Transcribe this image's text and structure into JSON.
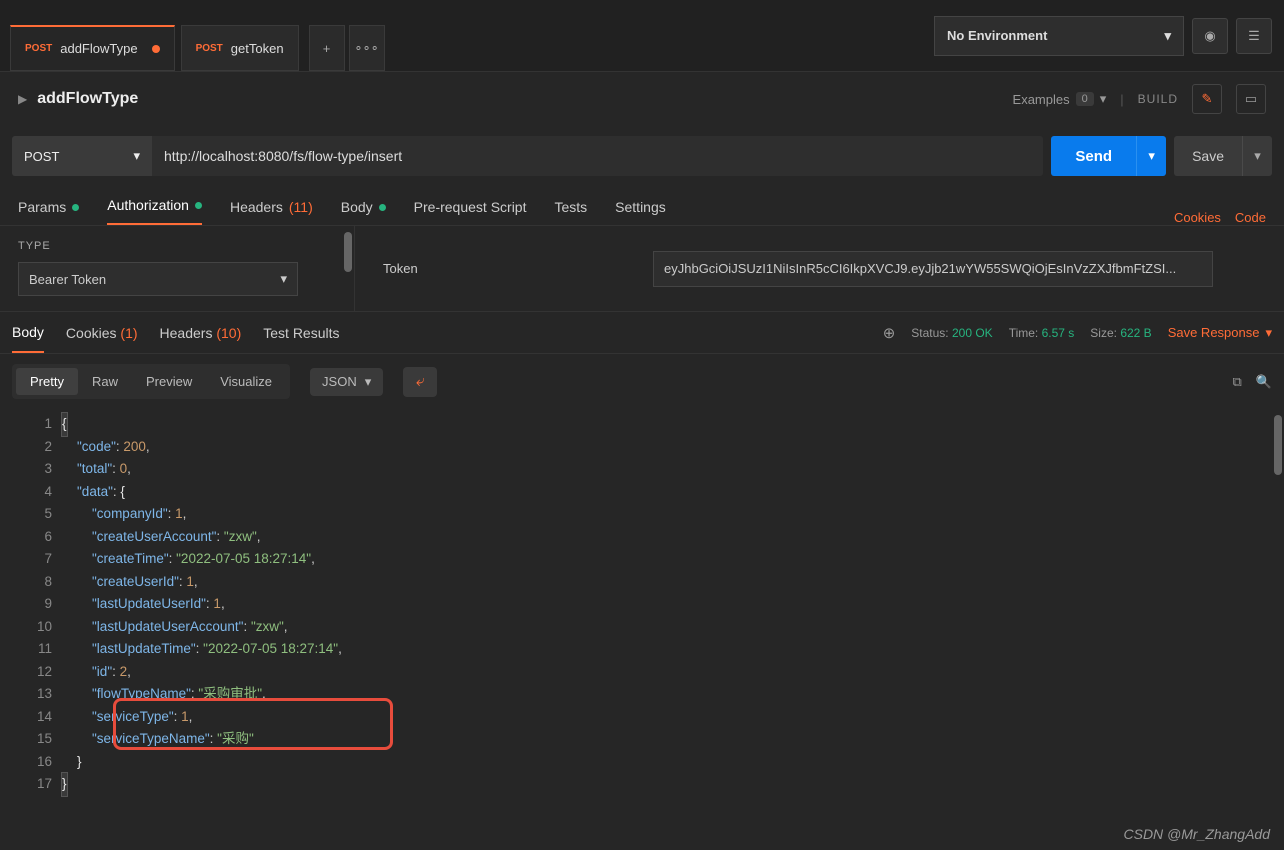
{
  "tabs": [
    {
      "method": "POST",
      "name": "addFlowType",
      "dirty": true,
      "active": true
    },
    {
      "method": "POST",
      "name": "getToken",
      "dirty": false,
      "active": false
    }
  ],
  "environment": {
    "selected": "No Environment"
  },
  "request": {
    "name": "addFlowType",
    "examples_label": "Examples",
    "examples_count": "0",
    "build_label": "BUILD",
    "method": "POST",
    "url": "http://localhost:8080/fs/flow-type/insert",
    "send_label": "Send",
    "save_label": "Save"
  },
  "request_tabs": {
    "params": "Params",
    "authorization": "Authorization",
    "headers": "Headers",
    "headers_count": "(11)",
    "body": "Body",
    "prerequest": "Pre-request Script",
    "tests": "Tests",
    "settings": "Settings",
    "cookies": "Cookies",
    "code": "Code"
  },
  "auth": {
    "type_label": "TYPE",
    "type_value": "Bearer Token",
    "token_label": "Token",
    "token_value": "eyJhbGciOiJSUzI1NiIsInR5cCI6IkpXVCJ9.eyJjb21wYW55SWQiOjEsInVzZXJfbmFtZSI..."
  },
  "response_tabs": {
    "body": "Body",
    "cookies": "Cookies",
    "cookies_count": "(1)",
    "headers": "Headers",
    "headers_count": "(10)",
    "test_results": "Test Results"
  },
  "response_meta": {
    "status_label": "Status:",
    "status_value": "200 OK",
    "time_label": "Time:",
    "time_value": "6.57 s",
    "size_label": "Size:",
    "size_value": "622 B",
    "save_response": "Save Response"
  },
  "view": {
    "pretty": "Pretty",
    "raw": "Raw",
    "preview": "Preview",
    "visualize": "Visualize",
    "format": "JSON"
  },
  "response_body": {
    "lines": [
      1,
      2,
      3,
      4,
      5,
      6,
      7,
      8,
      9,
      10,
      11,
      12,
      13,
      14,
      15,
      16,
      17
    ],
    "json": {
      "code": 200,
      "total": 0,
      "data": {
        "companyId": 1,
        "createUserAccount": "zxw",
        "createTime": "2022-07-05 18:27:14",
        "createUserId": 1,
        "lastUpdateUserId": 1,
        "lastUpdateUserAccount": "zxw",
        "lastUpdateTime": "2022-07-05 18:27:14",
        "id": 2,
        "flowTypeName": "采购审批",
        "serviceType": 1,
        "serviceTypeName": "采购"
      }
    }
  },
  "watermark": "CSDN @Mr_ZhangAdd"
}
